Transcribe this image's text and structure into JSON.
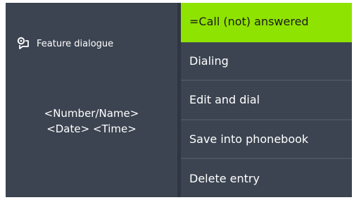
{
  "left_panel": {
    "feature_label": "Feature dialogue",
    "feature_icon": "feature-dialogue-icon",
    "entry_line1": "<Number/Name>",
    "entry_line2": "<Date> <Time>"
  },
  "menu": {
    "items": [
      {
        "label": "=Call (not) answered",
        "selected": true
      },
      {
        "label": "Dialing",
        "selected": false
      },
      {
        "label": "Edit and dial",
        "selected": false
      },
      {
        "label": "Save into phonebook",
        "selected": false
      },
      {
        "label": "Delete entry",
        "selected": false
      }
    ]
  },
  "colors": {
    "background": "#3c4451",
    "highlight": "#8fe300",
    "text": "#ffffff"
  }
}
